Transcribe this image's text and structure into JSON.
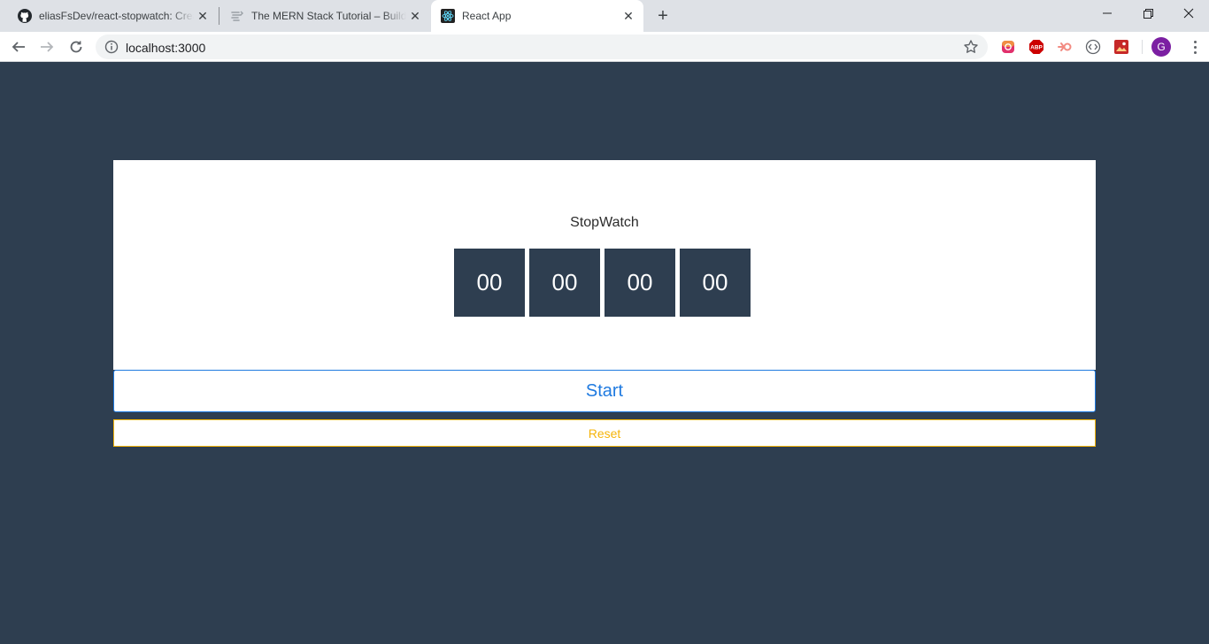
{
  "browser": {
    "tabs": [
      {
        "title": "eliasFsDev/react-stopwatch: Crea",
        "favicon": "github-icon",
        "active": false
      },
      {
        "title": "The MERN Stack Tutorial – Buildin",
        "favicon": "freecodecamp-icon",
        "active": false
      },
      {
        "title": "React App",
        "favicon": "react-icon",
        "active": true
      }
    ],
    "new_tab": "+",
    "address": "localhost:3000",
    "profile_initial": "G"
  },
  "app": {
    "title": "StopWatch",
    "digits": [
      "00",
      "00",
      "00",
      "00"
    ],
    "start_label": "Start",
    "reset_label": "Reset"
  },
  "colors": {
    "background": "#2e3e50",
    "digit_bg": "#2e3e50",
    "start_accent": "#1f7ae0",
    "reset_accent": "#f5b40a",
    "avatar": "#7b1fa2"
  }
}
